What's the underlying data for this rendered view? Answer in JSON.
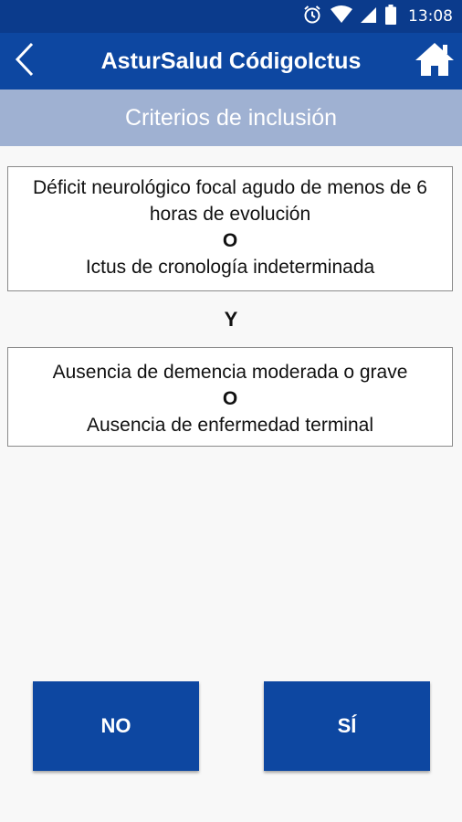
{
  "status_bar": {
    "time": "13:08",
    "icons": [
      "alarm-icon",
      "wifi-icon",
      "signal-icon",
      "battery-icon"
    ]
  },
  "app_bar": {
    "title": "AsturSalud CódigoIctus",
    "back_icon": "chevron-left-icon",
    "home_icon": "home-icon",
    "color": "#0d47a1"
  },
  "subheader": {
    "title": "Criterios de inclusión",
    "color": "#9fb1d2"
  },
  "criteria": {
    "box1": {
      "line1": "Déficit neurológico focal agudo de menos de 6 horas de evolución",
      "or": "O",
      "line2": "Ictus de cronología indeterminada"
    },
    "and": "Y",
    "box2": {
      "line1": "Ausencia de demencia moderada o grave",
      "or": "O",
      "line2": "Ausencia de enfermedad terminal"
    }
  },
  "actions": {
    "no_label": "NO",
    "yes_label": "SÍ"
  }
}
